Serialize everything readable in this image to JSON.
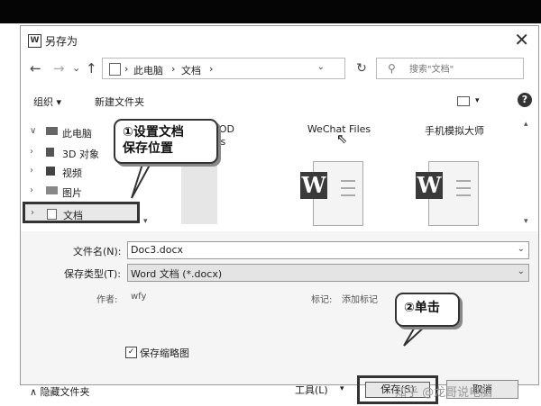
{
  "dialog": {
    "app_icon": "W",
    "title": "另存为",
    "close_symbol": "✕"
  },
  "nav": {
    "back": "←",
    "forward": "→",
    "recent": "⌄",
    "up": "↑",
    "breadcrumb": [
      "›",
      "此电脑",
      "›",
      "文档",
      "›"
    ],
    "dropdown": "⌄",
    "refresh": "↻",
    "search_placeholder": "搜索\"文档\""
  },
  "toolbar": {
    "organize": "组织 ▾",
    "new_folder": "新建文件夹",
    "view_dropdown": "▾",
    "help": "?"
  },
  "sidebar": {
    "items": [
      {
        "chevron": "∨",
        "label": "此电脑",
        "icon": "computer-icon"
      },
      {
        "chevron": "›",
        "label": "3D 对象",
        "icon": "3d-objects-icon"
      },
      {
        "chevron": "›",
        "label": "视频",
        "icon": "video-icon"
      },
      {
        "chevron": "›",
        "label": "图片",
        "icon": "pictures-icon"
      },
      {
        "chevron": "›",
        "label": "文档",
        "icon": "documents-icon"
      }
    ],
    "scroll_up": "▴",
    "scroll_down": "▾"
  },
  "files": {
    "items": [
      {
        "name": "nt OD",
        "name2": "es",
        "icon": "folder-icon"
      },
      {
        "name": "WeChat Files",
        "icon": "word-document-icon"
      },
      {
        "name": "手机模拟大师",
        "icon": "word-document-icon"
      }
    ],
    "word_badge": "W",
    "scroll_up": "▴",
    "scroll_down": "▾"
  },
  "form": {
    "filename_label": "文件名(N):",
    "filename_value": "Doc3.docx",
    "filetype_label": "保存类型(T):",
    "filetype_value": "Word 文档 (*.docx)",
    "author_label": "作者:",
    "author_value": "wfy",
    "tags_label": "标记:",
    "tags_value": "添加标记",
    "thumbnail_check": "✓",
    "thumbnail_label": "保存缩略图",
    "dropdown": "⌄"
  },
  "footer": {
    "hide_folders": "∧  隐藏文件夹",
    "tools": "工具(L)",
    "tools_dropdown": "▾",
    "save": "保存(S)",
    "cancel": "取消"
  },
  "callouts": {
    "step1": "①设置文档",
    "step1_line2": "保存位置",
    "step2": "②单击"
  },
  "watermark": "知乎 @龙哥说电脑",
  "cursor": "⇖"
}
